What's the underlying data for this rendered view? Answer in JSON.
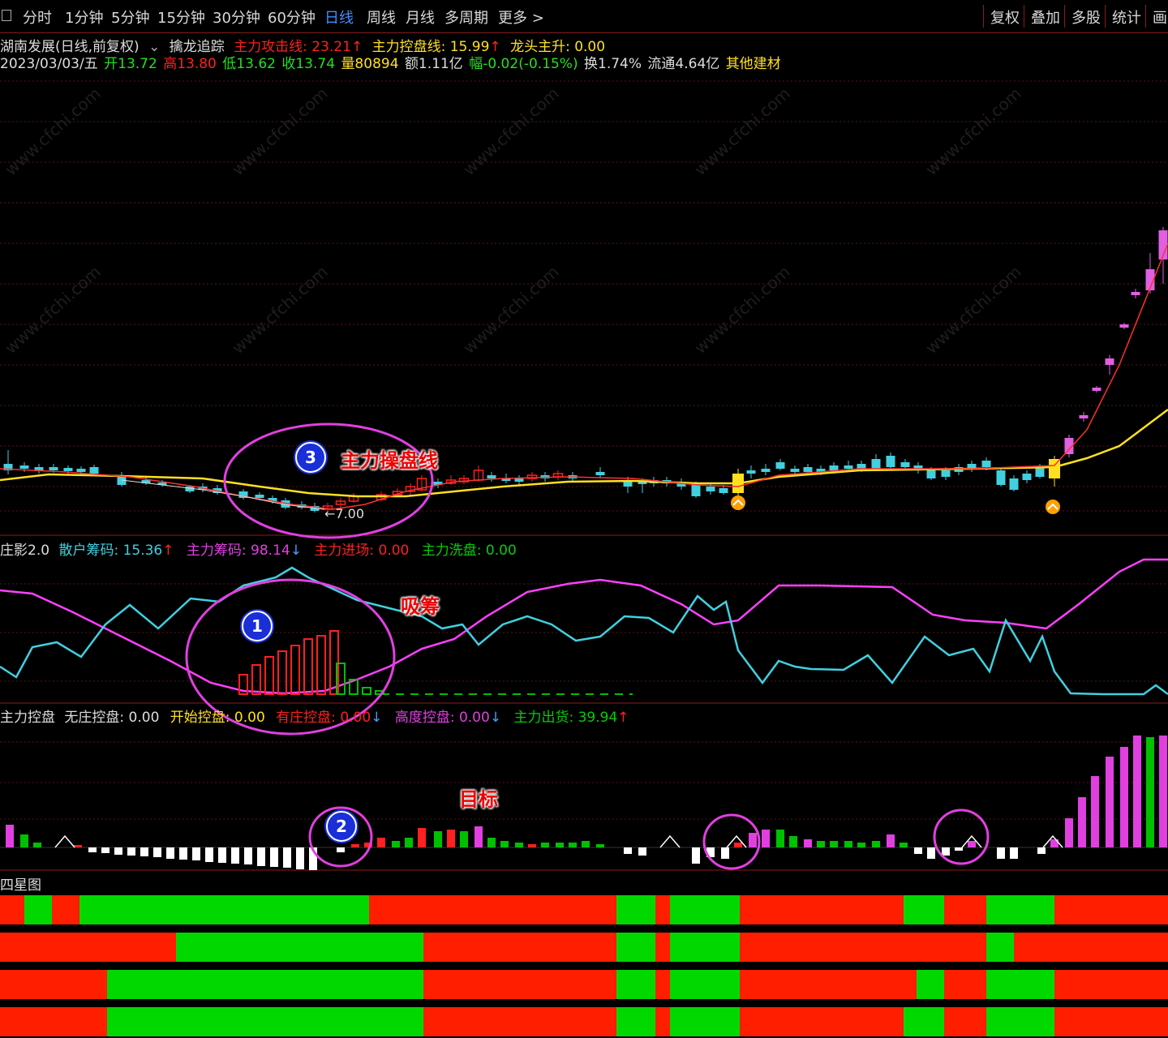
{
  "toolbar": {
    "tabs": [
      "分时",
      "1分钟",
      "5分钟",
      "15分钟",
      "30分钟",
      "60分钟",
      "日线",
      "周线",
      "月线",
      "多周期",
      "更多 >"
    ],
    "active_tab": "日线",
    "right_buttons": [
      "复权",
      "叠加",
      "多股",
      "统计",
      "画"
    ]
  },
  "main": {
    "stock_title": "湖南发展(日线,前复权)",
    "indicator_name": "擒龙追踪",
    "attack_line": "主力攻击线: 23.21",
    "control_line": "主力控盘线: 15.99",
    "dragon": "龙头主升: 0.00",
    "date": "2023/03/03/五",
    "open": "开13.72",
    "high": "高13.80",
    "low": "低13.62",
    "close": "收13.74",
    "volume": "量80894",
    "amount": "额1.11亿",
    "change": "幅-0.02(-0.15%)",
    "turnover": "换1.74%",
    "float": "流通4.64亿",
    "sector": "其他建材",
    "low_marker": "←7.00"
  },
  "sub1": {
    "name": "庄影2.0",
    "retail": "散户筹码: 15.36",
    "main_chips": "主力筹码: 98.14",
    "main_in": "主力进场: 0.00",
    "main_wash": "主力洗盘: 0.00"
  },
  "sub2": {
    "name": "主力控盘",
    "none": "无庄控盘: 0.00",
    "start": "开始控盘: 0.00",
    "has": "有庄控盘: 0.00",
    "high": "高度控盘: 0.00",
    "out": "主力出货: 39.94"
  },
  "sub3": {
    "name": "四星图"
  },
  "annotations": {
    "label3": "主力操盘线",
    "label1": "吸筹",
    "label2": "目标",
    "n1": "1",
    "n2": "2",
    "n3": "3"
  },
  "watermark": "www.cfchi.com",
  "colors": {
    "red": "#ff2020",
    "green": "#00c000",
    "magenta": "#e040e0",
    "cyan": "#40d0e0",
    "yellow": "#ffe020"
  }
}
